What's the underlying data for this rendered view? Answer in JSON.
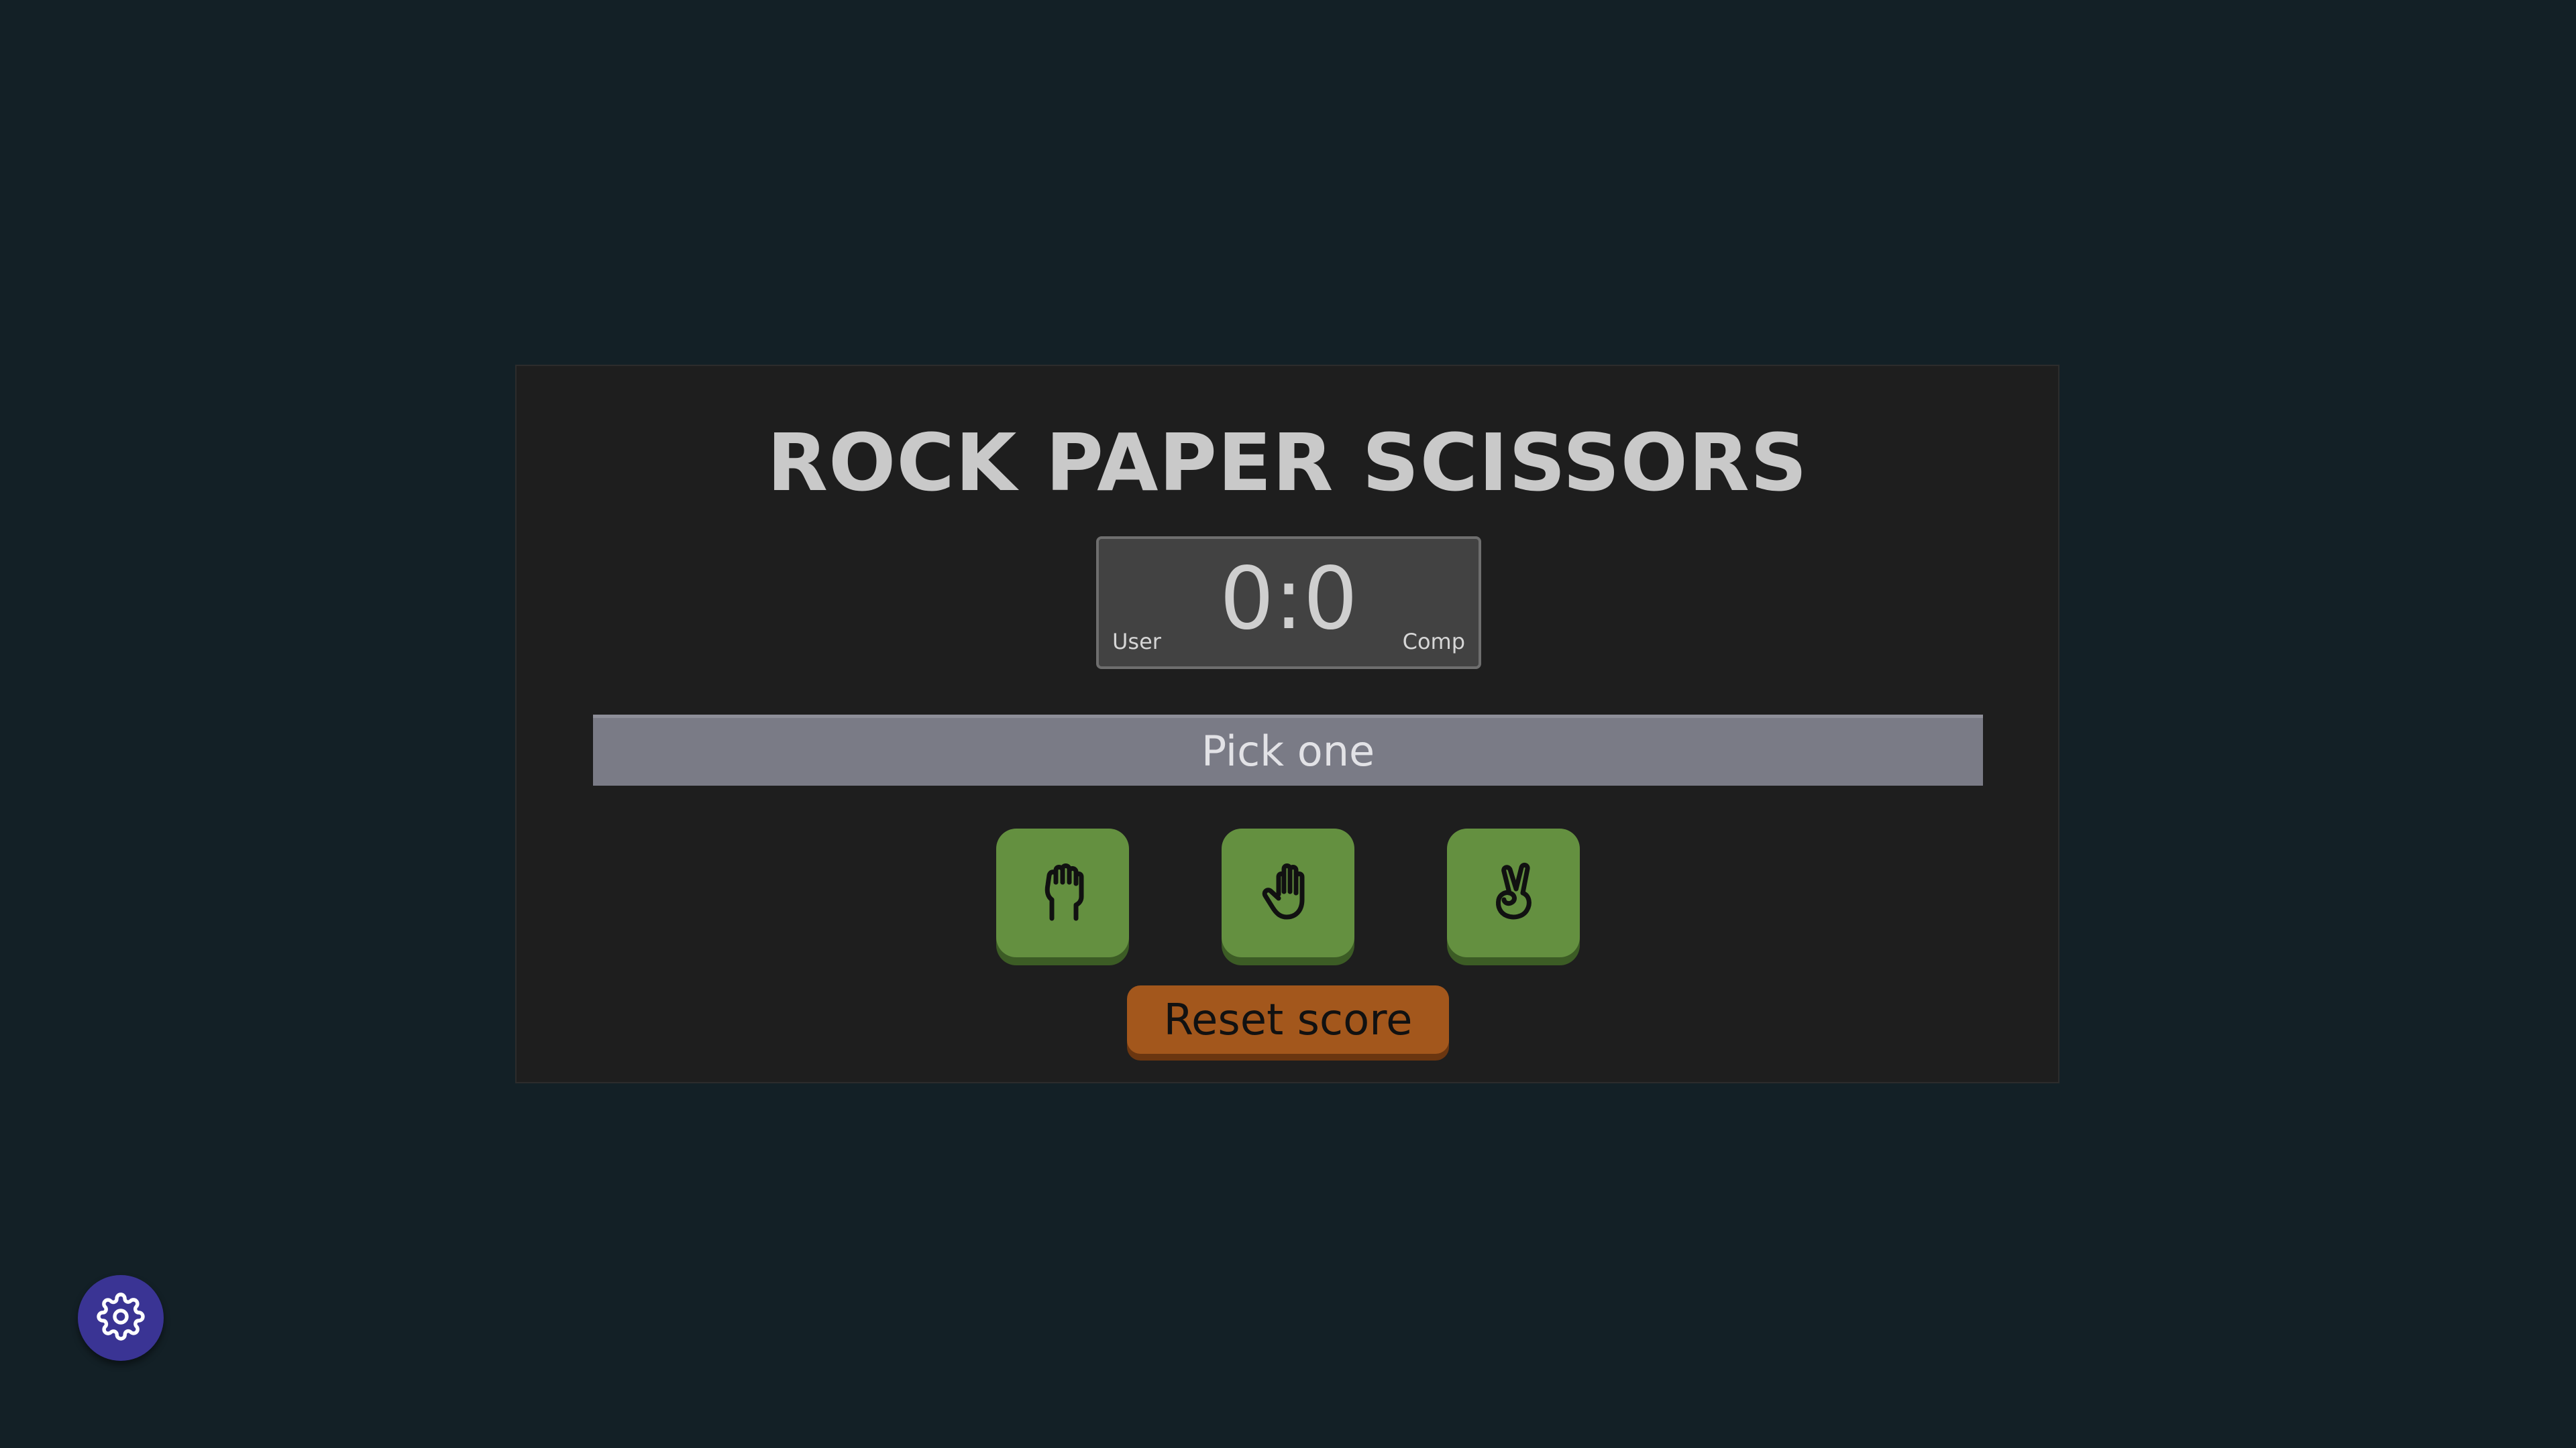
{
  "title": "ROCK PAPER SCISSORS",
  "scoreboard": {
    "score": "0:0",
    "user_label": "User",
    "comp_label": "Comp"
  },
  "message": "Pick one",
  "choices": [
    {
      "name": "rock",
      "icon": "fist-icon"
    },
    {
      "name": "paper",
      "icon": "open-hand-icon"
    },
    {
      "name": "scissors",
      "icon": "victory-hand-icon"
    }
  ],
  "reset_label": "Reset score",
  "settings_icon": "gear-icon",
  "colors": {
    "background": "#132026",
    "panel": "#1e1e1e",
    "choice_button": "#649040",
    "reset_button": "#a3571c",
    "settings_button": "#3a3494"
  }
}
